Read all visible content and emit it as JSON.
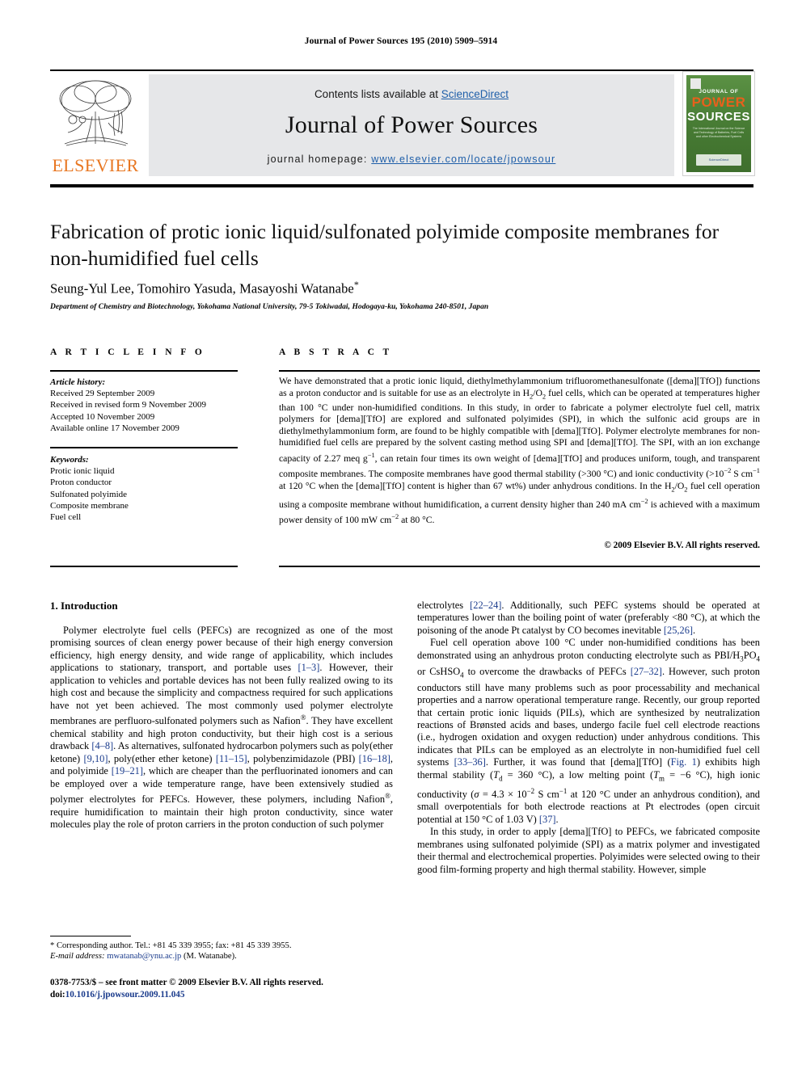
{
  "running_head": "Journal of Power Sources 195 (2010) 5909–5914",
  "masthead": {
    "contents_prefix": "Contents lists available at ",
    "sciencedirect": "ScienceDirect",
    "journal_title": "Journal of Power Sources",
    "homepage_prefix": "journal homepage: ",
    "homepage_url": "www.elsevier.com/locate/jpowsour",
    "publisher": "ELSEVIER",
    "accent_orange": "#E87722",
    "link_blue": "#1F5FA9",
    "cover": {
      "line1": "JOURNAL OF",
      "line2": "POWER",
      "line3": "SOURCES",
      "subtitle": "The International Journal on the Science and Technology of Batteries, Fuel Cells and other Electrochemical Systems",
      "badge": "ScienceDirect",
      "bg_color": "#4f8a3d"
    }
  },
  "article": {
    "title": "Fabrication of protic ionic liquid/sulfonated polyimide composite membranes for non-humidified fuel cells",
    "authors": "Seung-Yul Lee, Tomohiro Yasuda, Masayoshi Watanabe",
    "corresponding_mark": "*",
    "affiliation": "Department of Chemistry and Biotechnology, Yokohama National University, 79-5 Tokiwadai, Hodogaya-ku, Yokohama 240-8501, Japan"
  },
  "article_info": {
    "heading": "A R T I C L E   I N F O",
    "history_label": "Article history:",
    "history": [
      "Received 29 September 2009",
      "Received in revised form 9 November 2009",
      "Accepted 10 November 2009",
      "Available online 17 November 2009"
    ],
    "keywords_label": "Keywords:",
    "keywords": [
      "Protic ionic liquid",
      "Proton conductor",
      "Sulfonated polyimide",
      "Composite membrane",
      "Fuel cell"
    ]
  },
  "abstract": {
    "heading": "A B S T R A C T",
    "copyright": "© 2009 Elsevier B.V. All rights reserved."
  },
  "body": {
    "section1_heading": "1.  Introduction"
  },
  "footnote": {
    "corresponding": "* Corresponding author. Tel.: +81 45 339 3955; fax: +81 45 339 3955.",
    "email_label": "E-mail address:",
    "email": "mwatanab@ynu.ac.jp",
    "email_owner": "(M. Watanabe).",
    "issn_line": "0378-7753/$ – see front matter © 2009 Elsevier B.V. All rights reserved.",
    "doi_label": "doi:",
    "doi": "10.1016/j.jpowsour.2009.11.045"
  }
}
